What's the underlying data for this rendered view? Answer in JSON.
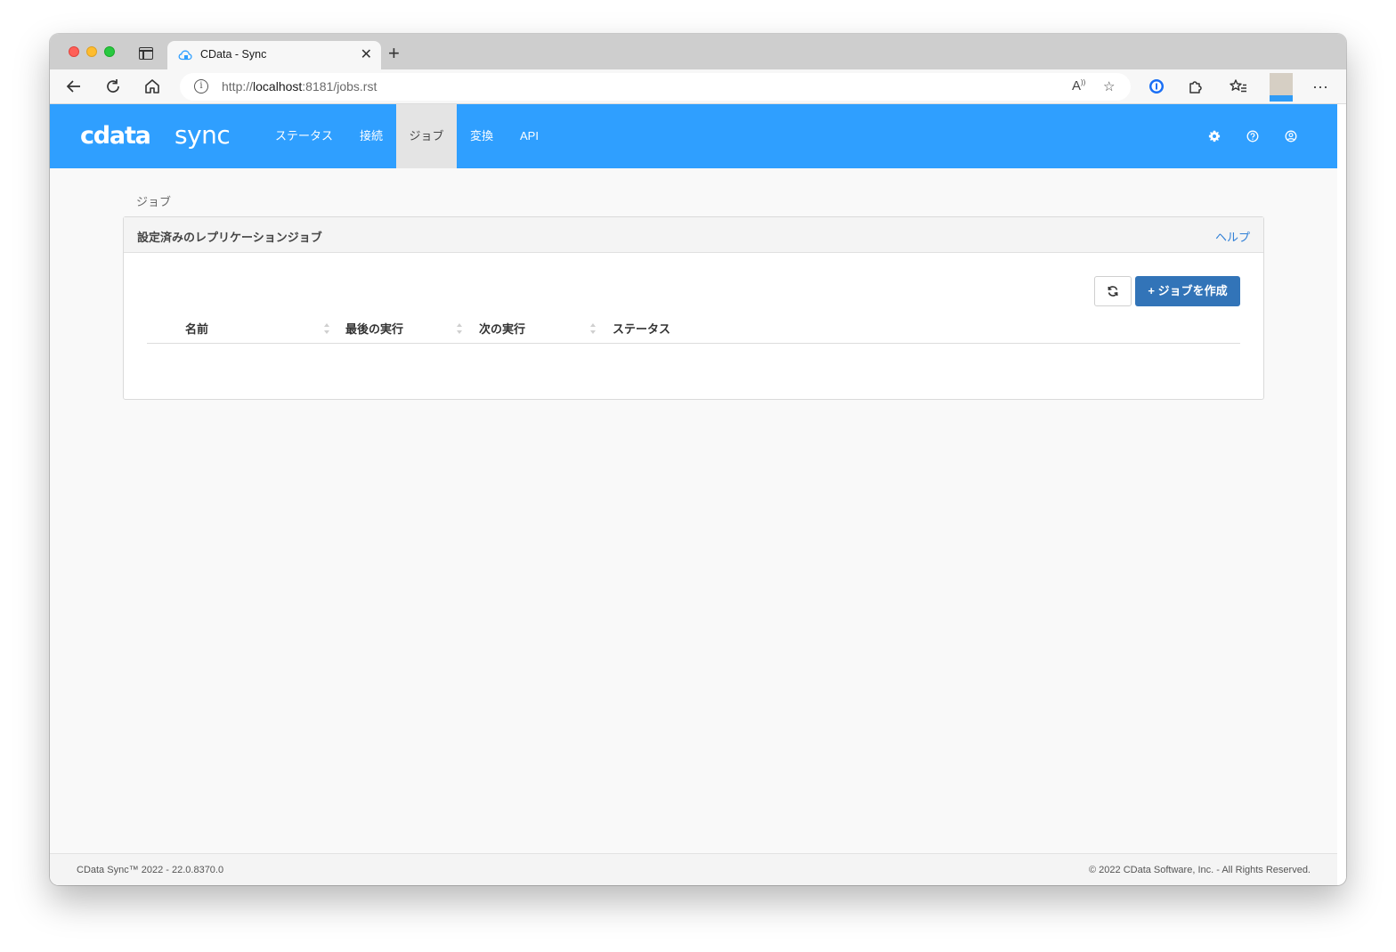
{
  "browser": {
    "tab_title": "CData - Sync",
    "url_prefix": "http://",
    "url_host": "localhost",
    "url_rest": ":8181/jobs.rst"
  },
  "app": {
    "logo_main": "cdata",
    "logo_product": "sync",
    "nav": [
      "ステータス",
      "接続",
      "ジョブ",
      "変換",
      "API"
    ],
    "active_nav": "ジョブ",
    "accent_color": "#2f9fff"
  },
  "page": {
    "breadcrumb": "ジョブ",
    "panel_title": "設定済みのレプリケーションジョブ",
    "help_link": "ヘルプ",
    "create_button": "+ ジョブを作成",
    "columns": [
      "名前",
      "最後の実行",
      "次の実行",
      "ステータス"
    ]
  },
  "footer": {
    "left": "CData Sync™ 2022 - 22.0.8370.0",
    "right": "© 2022 CData Software, Inc. - All Rights Reserved."
  }
}
